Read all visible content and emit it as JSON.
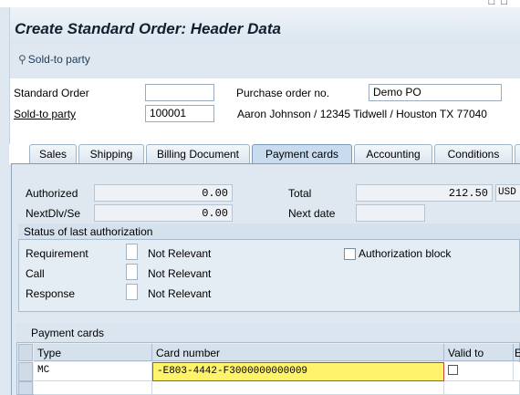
{
  "window": {
    "title": "Create Standard Order: Header Data",
    "top_icons": "□ □"
  },
  "toolbar": {
    "sold_to_party_button": "Sold-to party"
  },
  "header": {
    "standard_order_label": "Standard Order",
    "standard_order_value": "",
    "po_label": "Purchase order no.",
    "po_value": "Demo PO",
    "sold_to_label": "Sold-to party",
    "sold_to_value": "100001",
    "sold_to_address": "Aaron Johnson / 12345 Tidwell / Houston TX 77040"
  },
  "tabs": [
    "Sales",
    "Shipping",
    "Billing Document",
    "Payment cards",
    "Accounting",
    "Conditions"
  ],
  "active_tab": "Payment cards",
  "payment": {
    "authorized_label": "Authorized",
    "authorized_value": "0.00",
    "nextdlv_label": "NextDlv/Se",
    "nextdlv_value": "0.00",
    "total_label": "Total",
    "total_value": "212.50",
    "currency": "USD",
    "next_date_label": "Next date",
    "next_date_value": ""
  },
  "status_group": {
    "title": "Status of last authorization",
    "rows": [
      {
        "label": "Requirement",
        "value": "Not Relevant"
      },
      {
        "label": "Call",
        "value": "Not Relevant"
      },
      {
        "label": "Response",
        "value": "Not Relevant"
      }
    ],
    "auth_block_label": "Authorization block",
    "auth_block_checked": false
  },
  "cards_table": {
    "title": "Payment cards",
    "columns": [
      "Type",
      "Card number",
      "Valid to",
      "E"
    ],
    "rows": [
      {
        "type": "MC",
        "card_number": "-E803-4442-F3000000000009",
        "valid_to": ""
      }
    ]
  },
  "colors": {
    "highlight": "#fff36b",
    "accent": "#7d9ab8"
  }
}
